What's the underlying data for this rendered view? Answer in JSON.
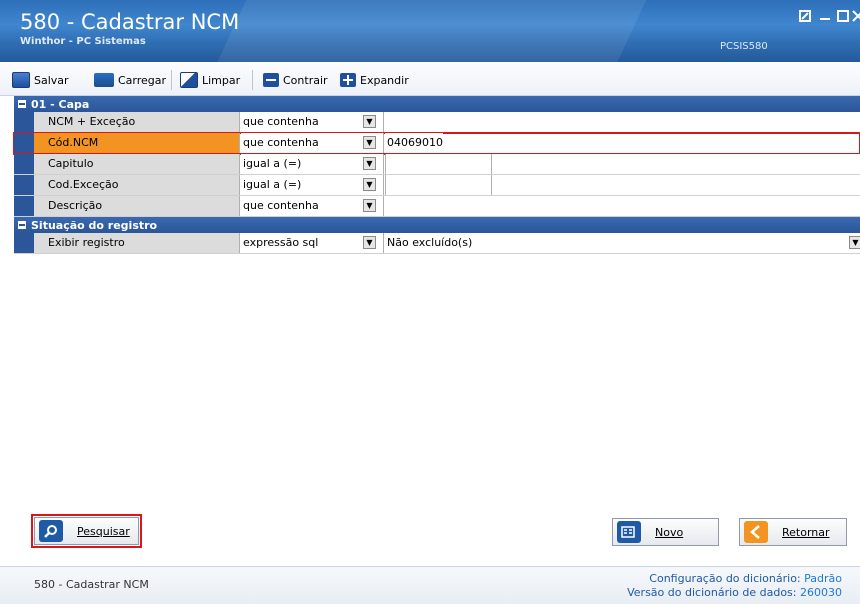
{
  "window": {
    "title": "580 - Cadastrar  NCM",
    "subtitle": "Winthor - PC Sistemas",
    "code": "PCSIS580",
    "controls": [
      "minimize",
      "restore",
      "close"
    ]
  },
  "toolbar": {
    "save_label": "Salvar",
    "load_label": "Carregar",
    "clear_label": "Limpar",
    "collapse_label": "Contrair",
    "expand_label": "Expandir"
  },
  "sections": [
    {
      "title": "01 - Capa",
      "rows": [
        {
          "label": "NCM + Exceção",
          "operator": "que contenha",
          "value": "",
          "value2": ""
        },
        {
          "label": "Cód.NCM",
          "operator": "que contenha",
          "value": "04069010",
          "value2": ""
        },
        {
          "label": "Capitulo",
          "operator": "igual a (=)",
          "value": "",
          "value2": ""
        },
        {
          "label": "Cod.Exceção",
          "operator": "igual a (=)",
          "value": "",
          "value2": ""
        },
        {
          "label": "Descrição",
          "operator": "que contenha",
          "value": "",
          "value2": ""
        }
      ]
    },
    {
      "title": "Situação do registro",
      "rows": [
        {
          "label": "Exibir registro",
          "operator": "expressão sql",
          "value": "Não excluído(s)",
          "value2": ""
        }
      ]
    }
  ],
  "buttons": {
    "search_label": "Pesquisar",
    "new_label": "Novo",
    "return_label": "Retornar"
  },
  "status": {
    "left": "580 - Cadastrar  NCM",
    "dict_config_label": "Configuração do dicionário:",
    "dict_config_value": "Padrão",
    "dict_version_label": "Versão do dicionário de dados:",
    "dict_version_value": "260030"
  },
  "colors": {
    "title_bar": "#3f86cf",
    "section_header": "#2b5699",
    "selected_row": "#f39322",
    "highlight_border": "#d9161c"
  }
}
